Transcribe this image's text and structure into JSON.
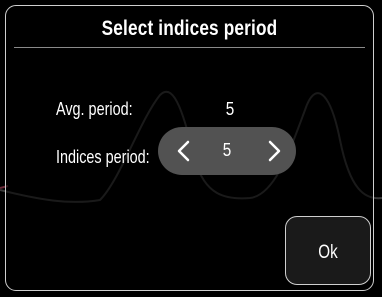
{
  "dialog": {
    "title": "Select indices period",
    "avg_period_label": "Avg. period:",
    "avg_period_value": "5",
    "indices_period_label": "Indices period:",
    "indices_period_value": "5",
    "ok_label": "Ok"
  },
  "icons": {
    "decrement": "chevron-left-icon",
    "increment": "chevron-right-icon"
  },
  "colors": {
    "background": "#000000",
    "border": "#cfcfcf",
    "stepper_fill": "#525252",
    "text": "#ffffff"
  }
}
